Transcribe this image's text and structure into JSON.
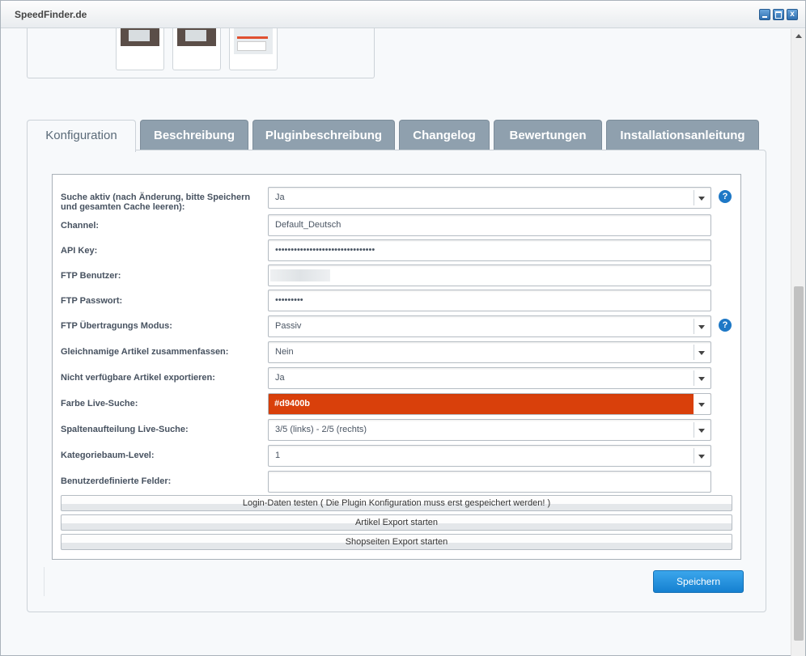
{
  "window": {
    "title": "SpeedFinder.de",
    "min_icon": "minimize-icon",
    "max_icon": "maximize-icon",
    "close_icon": "close-icon",
    "close_glyph": "x"
  },
  "tabs": [
    {
      "label": "Konfiguration",
      "active": true
    },
    {
      "label": "Beschreibung",
      "active": false
    },
    {
      "label": "Pluginbeschreibung",
      "active": false
    },
    {
      "label": "Changelog",
      "active": false
    },
    {
      "label": "Bewertungen",
      "active": false
    },
    {
      "label": "Installationsanleitung",
      "active": false
    }
  ],
  "form": {
    "search_active": {
      "label": "Suche aktiv (nach Änderung, bitte Speichern und gesamten Cache leeren):",
      "value": "Ja"
    },
    "channel": {
      "label": "Channel:",
      "value": "Default_Deutsch"
    },
    "api_key": {
      "label": "API Key:",
      "value": "••••••••••••••••••••••••••••••••"
    },
    "ftp_user": {
      "label": "FTP Benutzer:",
      "value": ""
    },
    "ftp_password": {
      "label": "FTP Passwort:",
      "value": "•••••••••"
    },
    "ftp_mode": {
      "label": "FTP Übertragungs Modus:",
      "value": "Passiv"
    },
    "merge_articles": {
      "label": "Gleichnamige Artikel zusammenfassen:",
      "value": "Nein"
    },
    "export_unavailable": {
      "label": "Nicht verfügbare Artikel exportieren:",
      "value": "Ja"
    },
    "live_search_color": {
      "label": "Farbe Live-Suche:",
      "value": "#d9400b",
      "color": "#d9400b"
    },
    "column_split": {
      "label": "Spaltenaufteilung Live-Suche:",
      "value": "3/5 (links) - 2/5 (rechts)"
    },
    "category_level": {
      "label": "Kategoriebaum-Level:",
      "value": "1"
    },
    "custom_fields": {
      "label": "Benutzerdefinierte Felder:",
      "value": ""
    }
  },
  "help_glyph": "?",
  "actions": {
    "test_login": "Login-Daten testen ( Die Plugin Konfiguration muss erst gespeichert werden! )",
    "export_articles": "Artikel Export starten",
    "export_shop_pages": "Shopseiten Export starten"
  },
  "save_label": "Speichern",
  "colors": {
    "accent": "#1e78c6",
    "tab_inactive": "#8fa0ae",
    "save_button": "#1580d0"
  }
}
